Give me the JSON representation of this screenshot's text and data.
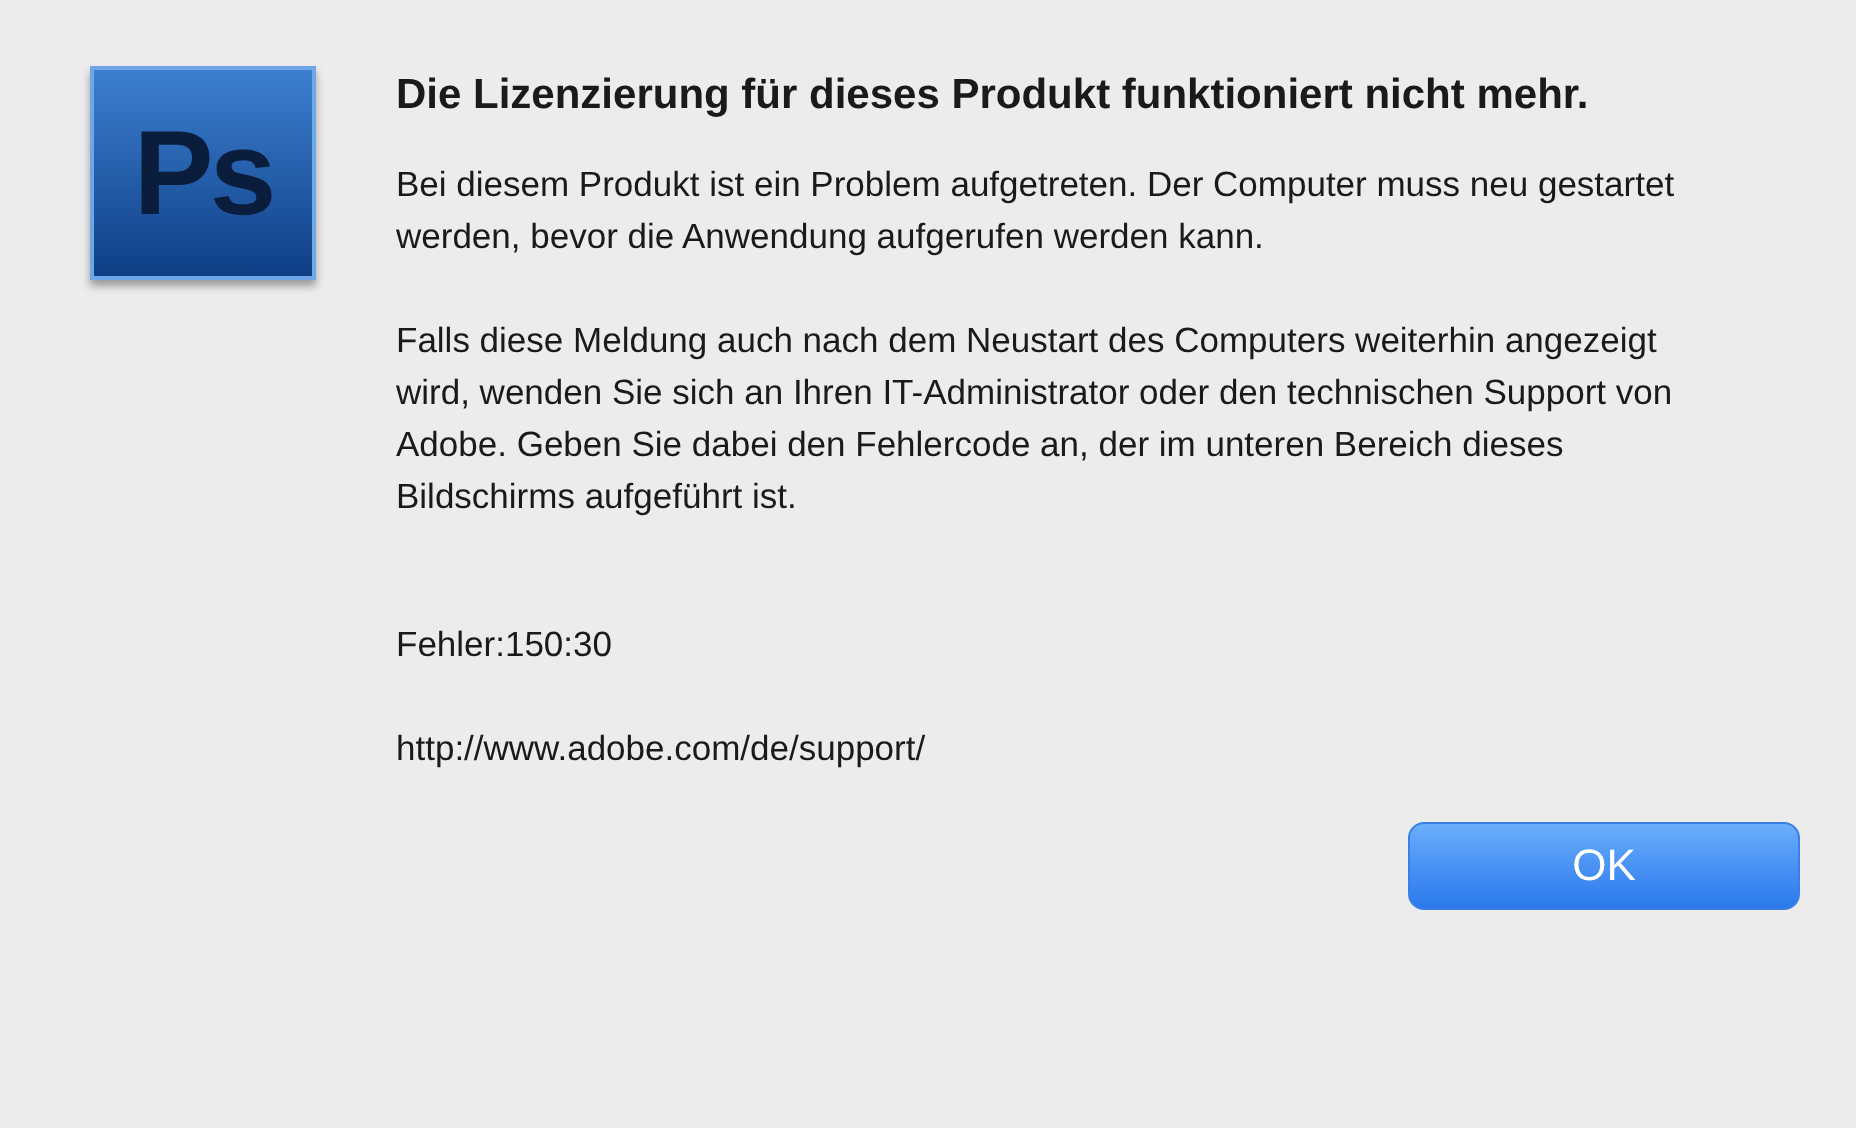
{
  "dialog": {
    "icon_label": "Ps",
    "title": "Die Lizenzierung für dieses Produkt funktioniert nicht mehr.",
    "paragraphs": [
      "Bei diesem Produkt ist ein Problem aufgetreten. Der Computer muss neu gestartet werden, bevor die Anwendung aufgerufen werden kann.",
      "Falls diese Meldung auch nach dem Neustart des Computers weiterhin angezeigt wird, wenden Sie sich an Ihren IT-Administrator oder den technischen Support von Adobe. Geben Sie dabei den Fehlercode an, der im unteren Bereich dieses Bildschirms aufgeführt ist."
    ],
    "error": "Fehler:150:30",
    "url": "http://www.adobe.com/de/support/",
    "buttons": [
      {
        "label": "OK",
        "default": true
      }
    ]
  }
}
